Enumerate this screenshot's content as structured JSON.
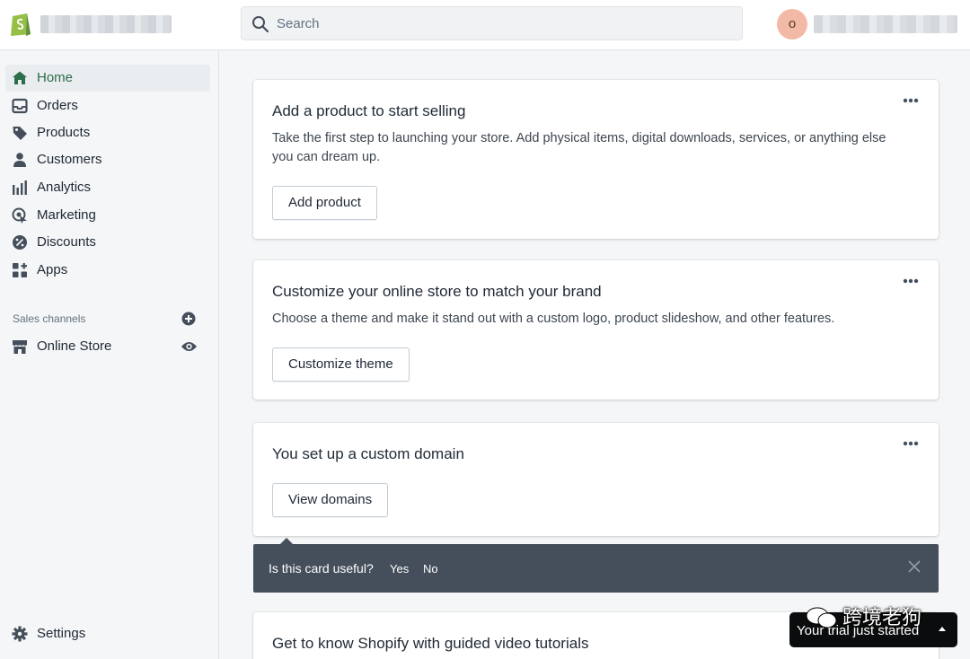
{
  "topbar": {
    "search_placeholder": "Search",
    "avatar_initial": "o"
  },
  "sidebar": {
    "items": [
      {
        "label": "Home",
        "icon": "home-icon",
        "active": true
      },
      {
        "label": "Orders",
        "icon": "orders-inbox-icon"
      },
      {
        "label": "Products",
        "icon": "tag-icon"
      },
      {
        "label": "Customers",
        "icon": "person-icon"
      },
      {
        "label": "Analytics",
        "icon": "bar-chart-icon"
      },
      {
        "label": "Marketing",
        "icon": "target-icon"
      },
      {
        "label": "Discounts",
        "icon": "discount-icon"
      },
      {
        "label": "Apps",
        "icon": "apps-grid-icon"
      }
    ],
    "sales_channels_title": "Sales channels",
    "channels": [
      {
        "label": "Online Store",
        "icon": "store-icon"
      }
    ],
    "settings_label": "Settings"
  },
  "cards": [
    {
      "title": "Add a product to start selling",
      "description": "Take the first step to launching your store. Add physical items, digital downloads, services, or anything else you can dream up.",
      "button": "Add product"
    },
    {
      "title": "Customize your online store to match your brand",
      "description": "Choose a theme and make it stand out with a custom logo, product slideshow, and other features.",
      "button": "Customize theme"
    },
    {
      "title": "You set up a custom domain",
      "button": "View domains"
    },
    {
      "title": "Get to know Shopify with guided video tutorials"
    }
  ],
  "feedback": {
    "question": "Is this card useful?",
    "yes": "Yes",
    "no": "No"
  },
  "trial_banner": {
    "text": "Your trial just started"
  },
  "watermark": {
    "text": "跨境老狗"
  },
  "colors": {
    "accent_green": "#2c6e49",
    "feedback_bg": "#454f5b",
    "avatar_bg": "#f1b9a6"
  }
}
